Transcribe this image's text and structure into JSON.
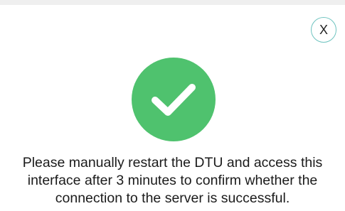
{
  "dialog": {
    "close_label": "X",
    "icon": "check-circle-icon",
    "accent_color": "#4fc26e",
    "message_lines": [
      "Please manually restart the DTU and access this",
      "interface after 3 minutes to confirm whether the",
      "connection to the server is successful."
    ]
  }
}
